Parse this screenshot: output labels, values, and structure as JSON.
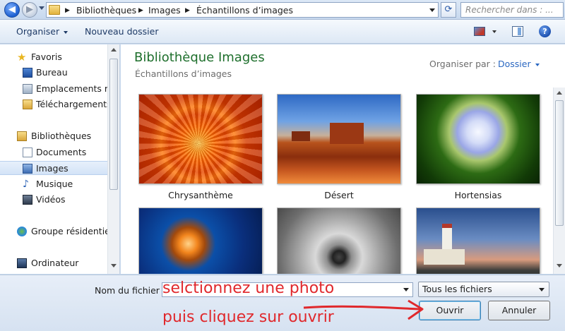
{
  "address": {
    "crumbs": [
      "Bibliothèques",
      "Images",
      "Échantillons d’images"
    ],
    "search_placeholder": "Rechercher dans : ..."
  },
  "toolbar": {
    "organize_label": "Organiser",
    "new_folder_label": "Nouveau dossier",
    "help_label": "?"
  },
  "nav": {
    "items": [
      {
        "label": "Favoris",
        "icon": "star-icon"
      },
      {
        "label": "Bureau",
        "icon": "desktop-icon"
      },
      {
        "label": "Emplacements réc",
        "icon": "recent-places-icon"
      },
      {
        "label": "Téléchargements",
        "icon": "downloads-icon"
      },
      {
        "label": "Bibliothèques",
        "icon": "libraries-icon"
      },
      {
        "label": "Documents",
        "icon": "documents-icon"
      },
      {
        "label": "Images",
        "icon": "pictures-icon",
        "selected": true
      },
      {
        "label": "Musique",
        "icon": "music-icon"
      },
      {
        "label": "Vidéos",
        "icon": "videos-icon"
      },
      {
        "label": "Groupe résidentiel",
        "icon": "homegroup-icon"
      },
      {
        "label": "Ordinateur",
        "icon": "computer-icon"
      }
    ]
  },
  "content": {
    "library_title": "Bibliothèque Images",
    "library_subtitle": "Échantillons d’images",
    "arrange_label": "Organiser par :",
    "arrange_value": "Dossier",
    "files": [
      {
        "name": "Chrysanthème"
      },
      {
        "name": "Désert"
      },
      {
        "name": "Hortensias"
      },
      {
        "name": ""
      },
      {
        "name": ""
      },
      {
        "name": ""
      }
    ]
  },
  "footer": {
    "filename_label": "Nom du fichier :",
    "filename_value": "",
    "filter_value": "Tous les fichiers",
    "open_label": "Ouvrir",
    "cancel_label": "Annuler"
  },
  "annotation": {
    "line1": "selctionnez une photo",
    "line2": "puis cliquez sur ouvrir",
    "color": "#e0282c"
  }
}
